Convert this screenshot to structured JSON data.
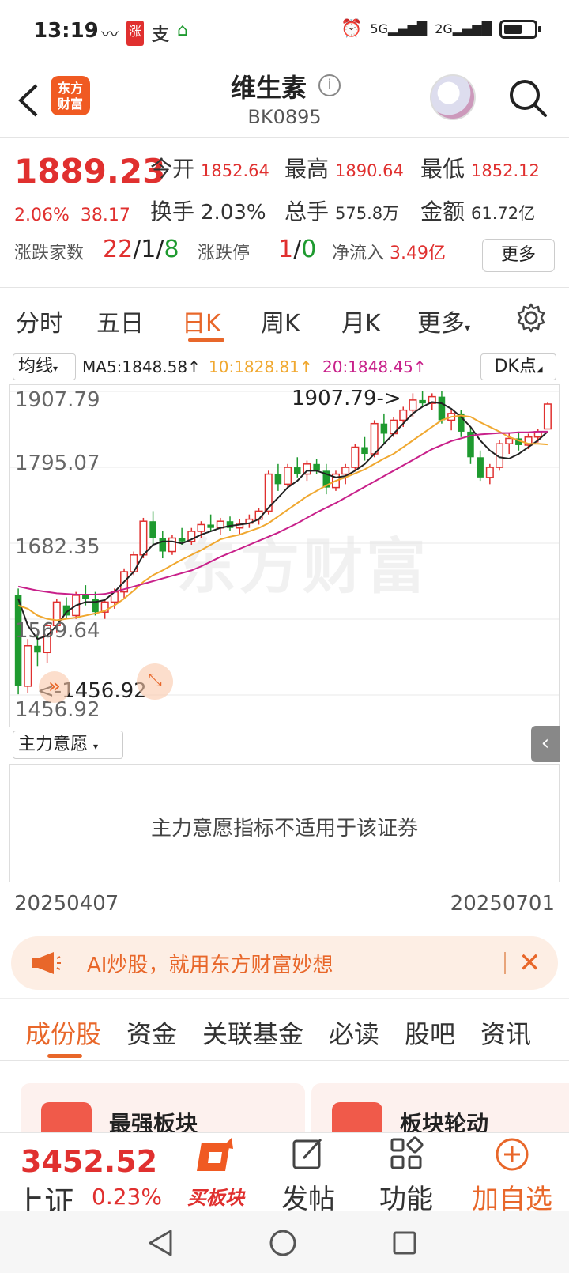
{
  "status": {
    "time": "13:19",
    "icons": [
      "wind-icon",
      "zhang-app-icon",
      "alipay-icon",
      "home-icon"
    ],
    "net1": "5G",
    "net2": "2G"
  },
  "header": {
    "logo_line1": "东方",
    "logo_line2": "财富",
    "title": "维生素",
    "code": "BK0895",
    "info_glyph": "i"
  },
  "quote": {
    "price": "1889.23",
    "change_pct": "2.06%",
    "change_abs": "38.17",
    "open_label": "今开",
    "open": "1852.64",
    "high_label": "最高",
    "high": "1890.64",
    "low_label": "最低",
    "low": "1852.12",
    "turnover_label": "换手",
    "turnover": "2.03%",
    "volume_label": "总手",
    "volume": "575.8万",
    "amount_label": "金额",
    "amount": "61.72亿",
    "updown_label": "涨跌家数",
    "up": "22",
    "flat": "1",
    "down": "8",
    "limit_label": "涨跌停",
    "limit_up": "1",
    "limit_down": "0",
    "netflow_label": "净流入",
    "netflow": "3.49亿",
    "more_label": "更多",
    "slash": "/"
  },
  "period_tabs": {
    "items": [
      "分时",
      "五日",
      "日K",
      "周K",
      "月K",
      "更多"
    ],
    "active": "日K"
  },
  "ma": {
    "select_label": "均线",
    "ma5": "MA5:1848.58↑",
    "ma10": "10:1828.81↑",
    "ma20": "20:1848.45↑",
    "dk_label": "DK点",
    "colors": {
      "ma5": "#222222",
      "ma10": "#f0a830",
      "ma20": "#c8208a"
    }
  },
  "chart": {
    "watermark": "东方财富",
    "y_labels": [
      "1907.79",
      "1795.07",
      "1682.35",
      "1569.64",
      "1456.92"
    ],
    "max_marker": "1907.79->",
    "min_marker": "<-1456.92",
    "start_date": "20250407",
    "end_date": "20250701"
  },
  "indicator": {
    "select_label": "主力意愿",
    "message": "主力意愿指标不适用于该证券"
  },
  "chart_data": {
    "type": "candlestick",
    "title": "",
    "ylim": [
      1456.92,
      1907.79
    ],
    "y_ticks": [
      1907.79,
      1795.07,
      1682.35,
      1569.64,
      1456.92
    ],
    "x_range": [
      "20250407",
      "20250701"
    ],
    "candles": [
      [
        1605,
        1615,
        1458,
        1470
      ],
      [
        1470,
        1540,
        1460,
        1530
      ],
      [
        1530,
        1545,
        1500,
        1520
      ],
      [
        1520,
        1565,
        1505,
        1560
      ],
      [
        1560,
        1600,
        1550,
        1595
      ],
      [
        1590,
        1602,
        1570,
        1575
      ],
      [
        1575,
        1610,
        1570,
        1605
      ],
      [
        1605,
        1620,
        1590,
        1600
      ],
      [
        1600,
        1610,
        1575,
        1580
      ],
      [
        1580,
        1600,
        1570,
        1595
      ],
      [
        1595,
        1615,
        1585,
        1610
      ],
      [
        1610,
        1645,
        1600,
        1640
      ],
      [
        1640,
        1670,
        1635,
        1665
      ],
      [
        1665,
        1720,
        1660,
        1715
      ],
      [
        1715,
        1730,
        1680,
        1690
      ],
      [
        1690,
        1700,
        1660,
        1670
      ],
      [
        1670,
        1695,
        1665,
        1690
      ],
      [
        1690,
        1705,
        1680,
        1685
      ],
      [
        1685,
        1705,
        1680,
        1700
      ],
      [
        1700,
        1715,
        1690,
        1710
      ],
      [
        1710,
        1725,
        1700,
        1705
      ],
      [
        1705,
        1720,
        1695,
        1715
      ],
      [
        1715,
        1722,
        1700,
        1705
      ],
      [
        1705,
        1718,
        1695,
        1712
      ],
      [
        1712,
        1725,
        1705,
        1718
      ],
      [
        1718,
        1735,
        1710,
        1730
      ],
      [
        1730,
        1790,
        1725,
        1785
      ],
      [
        1785,
        1800,
        1760,
        1770
      ],
      [
        1770,
        1800,
        1765,
        1795
      ],
      [
        1795,
        1810,
        1780,
        1785
      ],
      [
        1785,
        1805,
        1775,
        1800
      ],
      [
        1800,
        1808,
        1785,
        1790
      ],
      [
        1790,
        1800,
        1755,
        1765
      ],
      [
        1765,
        1790,
        1760,
        1785
      ],
      [
        1785,
        1800,
        1770,
        1795
      ],
      [
        1795,
        1830,
        1790,
        1825
      ],
      [
        1825,
        1840,
        1805,
        1815
      ],
      [
        1815,
        1865,
        1810,
        1860
      ],
      [
        1860,
        1875,
        1830,
        1845
      ],
      [
        1845,
        1870,
        1840,
        1865
      ],
      [
        1865,
        1885,
        1855,
        1880
      ],
      [
        1880,
        1905,
        1870,
        1895
      ],
      [
        1895,
        1908,
        1885,
        1890
      ],
      [
        1890,
        1905,
        1880,
        1900
      ],
      [
        1900,
        1908,
        1860,
        1865
      ],
      [
        1865,
        1880,
        1850,
        1875
      ],
      [
        1875,
        1880,
        1840,
        1848
      ],
      [
        1848,
        1855,
        1800,
        1810
      ],
      [
        1810,
        1820,
        1775,
        1780
      ],
      [
        1780,
        1800,
        1770,
        1795
      ],
      [
        1795,
        1835,
        1790,
        1830
      ],
      [
        1830,
        1845,
        1815,
        1838
      ],
      [
        1838,
        1848,
        1820,
        1828
      ],
      [
        1828,
        1845,
        1822,
        1840
      ],
      [
        1840,
        1852,
        1832,
        1848
      ],
      [
        1852,
        1891,
        1852,
        1889
      ]
    ],
    "series": [
      {
        "name": "MA5",
        "color": "#222222",
        "values": [
          1600,
          1560,
          1540,
          1545,
          1560,
          1580,
          1590,
          1595,
          1595,
          1598,
          1610,
          1625,
          1640,
          1665,
          1680,
          1685,
          1685,
          1682,
          1688,
          1695,
          1700,
          1705,
          1708,
          1710,
          1712,
          1718,
          1735,
          1750,
          1765,
          1775,
          1790,
          1790,
          1785,
          1780,
          1782,
          1790,
          1800,
          1815,
          1830,
          1845,
          1860,
          1875,
          1885,
          1892,
          1890,
          1882,
          1870,
          1855,
          1835,
          1820,
          1810,
          1808,
          1815,
          1825,
          1835,
          1848
        ]
      },
      {
        "name": "MA10",
        "color": "#f0a830",
        "values": [
          1590,
          1585,
          1575,
          1570,
          1568,
          1570,
          1572,
          1575,
          1578,
          1582,
          1590,
          1600,
          1612,
          1625,
          1635,
          1642,
          1650,
          1658,
          1665,
          1672,
          1680,
          1688,
          1692,
          1695,
          1700,
          1705,
          1712,
          1722,
          1732,
          1742,
          1752,
          1760,
          1768,
          1775,
          1780,
          1786,
          1792,
          1800,
          1808,
          1815,
          1825,
          1835,
          1845,
          1855,
          1865,
          1870,
          1872,
          1870,
          1862,
          1855,
          1848,
          1840,
          1835,
          1830,
          1830,
          1829
        ]
      },
      {
        "name": "MA20",
        "color": "#c8208a",
        "values": [
          1618,
          1615,
          1612,
          1610,
          1608,
          1607,
          1606,
          1606,
          1606,
          1607,
          1610,
          1614,
          1618,
          1622,
          1626,
          1630,
          1634,
          1638,
          1642,
          1648,
          1655,
          1662,
          1668,
          1674,
          1680,
          1686,
          1692,
          1698,
          1705,
          1712,
          1720,
          1728,
          1735,
          1742,
          1750,
          1758,
          1766,
          1774,
          1782,
          1790,
          1798,
          1806,
          1814,
          1822,
          1828,
          1834,
          1838,
          1842,
          1844,
          1845,
          1846,
          1846,
          1847,
          1847,
          1848,
          1848
        ]
      }
    ]
  },
  "banner": {
    "text": "AI炒股，就用东方财富妙想"
  },
  "section_tabs": {
    "items": [
      "成份股",
      "资金",
      "关联基金",
      "必读",
      "股吧",
      "资讯"
    ],
    "active": "成份股"
  },
  "cards": [
    {
      "title": "最强板块"
    },
    {
      "title": "板块轮动"
    }
  ],
  "bottom_bar": {
    "index_value": "3452.52",
    "index_name": "上证",
    "index_pct": "0.23%",
    "buttons": [
      "买板块",
      "发帖",
      "功能",
      "加自选"
    ]
  }
}
